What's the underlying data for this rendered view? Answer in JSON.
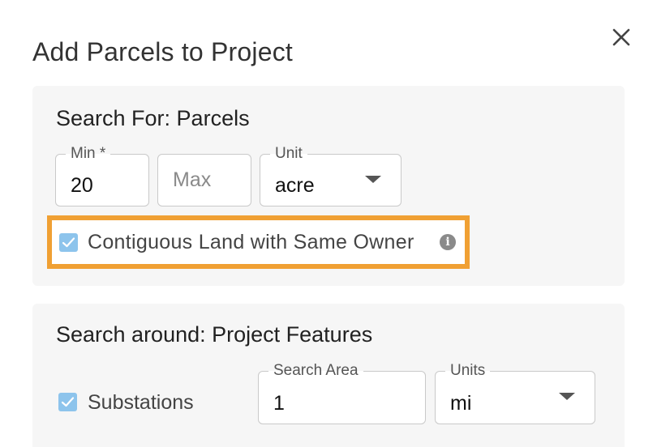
{
  "dialog": {
    "title": "Add Parcels to Project",
    "close_label": "×"
  },
  "search_for": {
    "title": "Search For: Parcels",
    "min": {
      "label": "Min *",
      "value": "20"
    },
    "max": {
      "placeholder": "Max",
      "value": ""
    },
    "unit": {
      "label": "Unit",
      "value": "acre"
    },
    "contiguous": {
      "label": "Contiguous Land with Same Owner",
      "checked": true,
      "info_icon": "i"
    }
  },
  "search_around": {
    "title": "Search around: Project Features",
    "substations": {
      "label": "Substations",
      "checked": true
    },
    "search_area": {
      "label": "Search Area",
      "value": "1"
    },
    "units": {
      "label": "Units",
      "value": "mi"
    }
  },
  "colors": {
    "highlight": "#f0a033",
    "checkbox": "#8dc4ec",
    "section_bg": "#f6f6f6"
  }
}
